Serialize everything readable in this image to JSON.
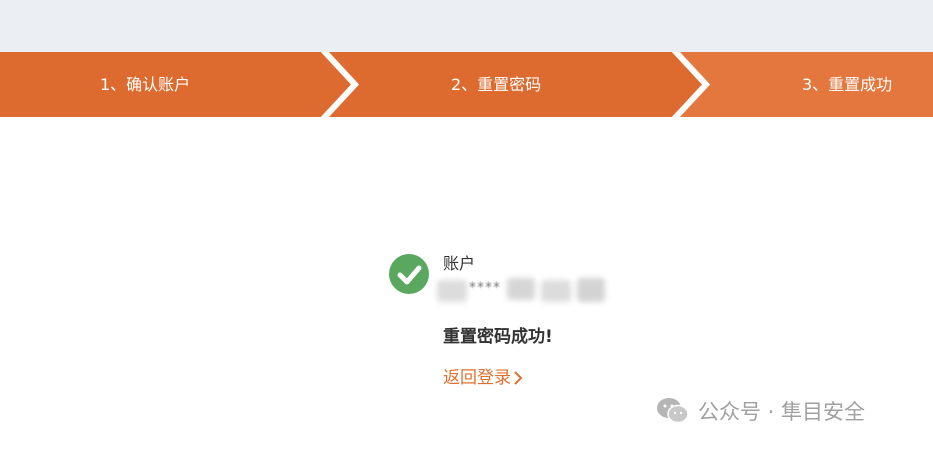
{
  "steps": [
    {
      "label": "1、确认账户"
    },
    {
      "label": "2、重置密码"
    },
    {
      "label": "3、重置成功"
    }
  ],
  "colors": {
    "step_primary": "#dd6b30",
    "step_active": "#e4773e",
    "success_green": "#5aa75f",
    "link_orange": "#e0702f",
    "header_band": "#ebeef2"
  },
  "result": {
    "account_label": "账户",
    "account_value_masked": "****",
    "success_message": "重置密码成功!",
    "back_link": "返回登录"
  },
  "watermark": {
    "text": "公众号 · 隼目安全",
    "icon": "wechat-icon"
  }
}
